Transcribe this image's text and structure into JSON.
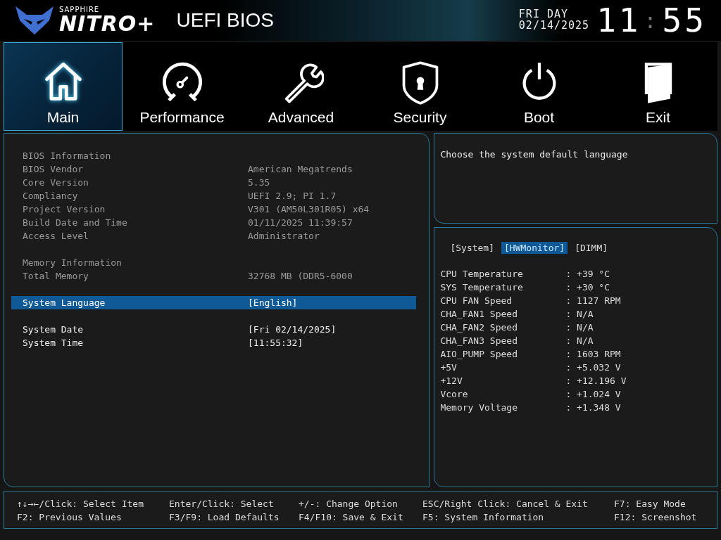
{
  "brand": {
    "maker": "SAPPHIRE",
    "logo": "NITRO+",
    "product": "UEFI BIOS"
  },
  "clock": {
    "day": "FRI DAY",
    "date": "02/14/2025",
    "hours": "11",
    "separator": ":",
    "minutes": "55"
  },
  "tabs": [
    {
      "label": "Main",
      "selected": true
    },
    {
      "label": "Performance",
      "selected": false
    },
    {
      "label": "Advanced",
      "selected": false
    },
    {
      "label": "Security",
      "selected": false
    },
    {
      "label": "Boot",
      "selected": false
    },
    {
      "label": "Exit",
      "selected": false
    }
  ],
  "main_panel": {
    "sections": [
      {
        "title": "BIOS Information",
        "items": [
          {
            "label": "BIOS Vendor",
            "value": "American Megatrends",
            "kind": "info",
            "selected": false
          },
          {
            "label": "Core Version",
            "value": "5.35",
            "kind": "info",
            "selected": false
          },
          {
            "label": "Compliancy",
            "value": "UEFI 2.9; PI 1.7",
            "kind": "info",
            "selected": false
          },
          {
            "label": "Project Version",
            "value": "V301 (AM50L301R05) x64",
            "kind": "info",
            "selected": false
          },
          {
            "label": "Build Date and Time",
            "value": "01/11/2025 11:39:57",
            "kind": "info",
            "selected": false
          },
          {
            "label": "Access Level",
            "value": "Administrator",
            "kind": "info",
            "selected": false
          }
        ]
      },
      {
        "title": "Memory Information",
        "items": [
          {
            "label": "Total Memory",
            "value": "32768 MB (DDR5-6000",
            "kind": "info",
            "selected": false
          }
        ]
      },
      {
        "items": [
          {
            "label": "System Language",
            "value": "[English]",
            "kind": "setting",
            "selected": true
          }
        ]
      },
      {
        "items": [
          {
            "label": "System Date",
            "value": "[Fri 02/14/2025]",
            "kind": "setting",
            "selected": false
          },
          {
            "label": "System Time",
            "value": "[11:55:32]",
            "kind": "setting",
            "selected": false
          }
        ]
      }
    ]
  },
  "help_panel": {
    "text": "Choose the system default language"
  },
  "monitor_panel": {
    "tabs": [
      {
        "label": "[System]",
        "selected": false
      },
      {
        "label": "[HWMonitor]",
        "selected": true
      },
      {
        "label": "[DIMM]",
        "selected": false
      }
    ],
    "readings": [
      {
        "label": "CPU Temperature",
        "value": ": +39 °C"
      },
      {
        "label": "SYS Temperature",
        "value": ": +30 °C"
      },
      {
        "label": "CPU FAN Speed",
        "value": ": 1127 RPM"
      },
      {
        "label": "CHA_FAN1 Speed",
        "value": ": N/A"
      },
      {
        "label": "CHA_FAN2 Speed",
        "value": ": N/A"
      },
      {
        "label": "CHA_FAN3 Speed",
        "value": ": N/A"
      },
      {
        "label": "AIO_PUMP Speed",
        "value": ": 1603 RPM"
      },
      {
        "label": "+5V",
        "value": ": +5.032 V"
      },
      {
        "label": "+12V",
        "value": ": +12.196 V"
      },
      {
        "label": "Vcore",
        "value": ": +1.024 V"
      },
      {
        "label": "Memory Voltage",
        "value": ": +1.348 V"
      }
    ]
  },
  "key_hints": [
    [
      "↑↓→←/Click: Select Item",
      "F2: Previous Values"
    ],
    [
      "Enter/Click: Select",
      "F3/F9: Load Defaults"
    ],
    [
      "+/-: Change Option",
      "F4/F10: Save & Exit"
    ],
    [
      "ESC/Right Click: Cancel & Exit",
      "F5: System Information"
    ],
    [
      "F7: Easy Mode",
      "F12: Screenshot"
    ]
  ]
}
